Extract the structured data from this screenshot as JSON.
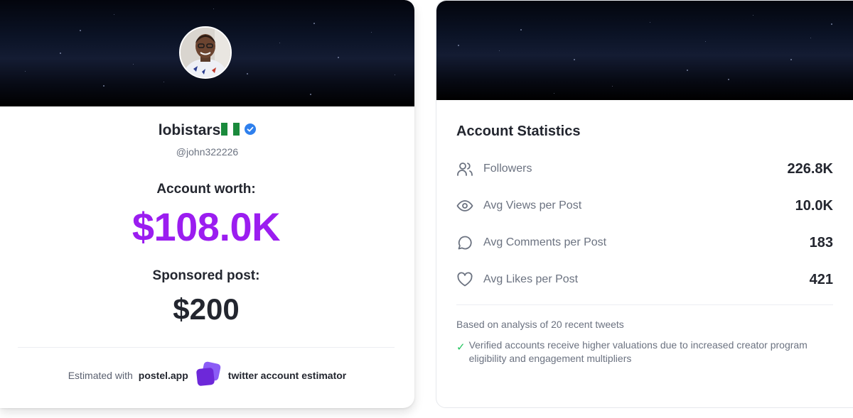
{
  "profile": {
    "display_name": "lobistars",
    "handle": "@john322226",
    "verified": true
  },
  "valuation": {
    "worth_label": "Account worth:",
    "worth_value": "$108.0K",
    "sponsored_label": "Sponsored post:",
    "sponsored_value": "$200"
  },
  "footer": {
    "prefix": "Estimated with",
    "app_name": "postel.app",
    "suffix": "twitter account estimator"
  },
  "stats": {
    "title": "Account Statistics",
    "rows": [
      {
        "icon": "users-icon",
        "label": "Followers",
        "value": "226.8K"
      },
      {
        "icon": "eye-icon",
        "label": "Avg Views per Post",
        "value": "10.0K"
      },
      {
        "icon": "comment-icon",
        "label": "Avg Comments per Post",
        "value": "183"
      },
      {
        "icon": "heart-icon",
        "label": "Avg Likes per Post",
        "value": "421"
      }
    ],
    "analysis_note": "Based on analysis of 20 recent tweets",
    "verified_note": "Verified accounts receive higher valuations due to increased creator program eligibility and engagement multipliers"
  },
  "colors": {
    "accent": "#9b1df0",
    "text": "#23262f",
    "muted": "#6b7280",
    "verified_badge": "#2f80ed",
    "check": "#22c55e",
    "logo": "#6d28d9"
  }
}
